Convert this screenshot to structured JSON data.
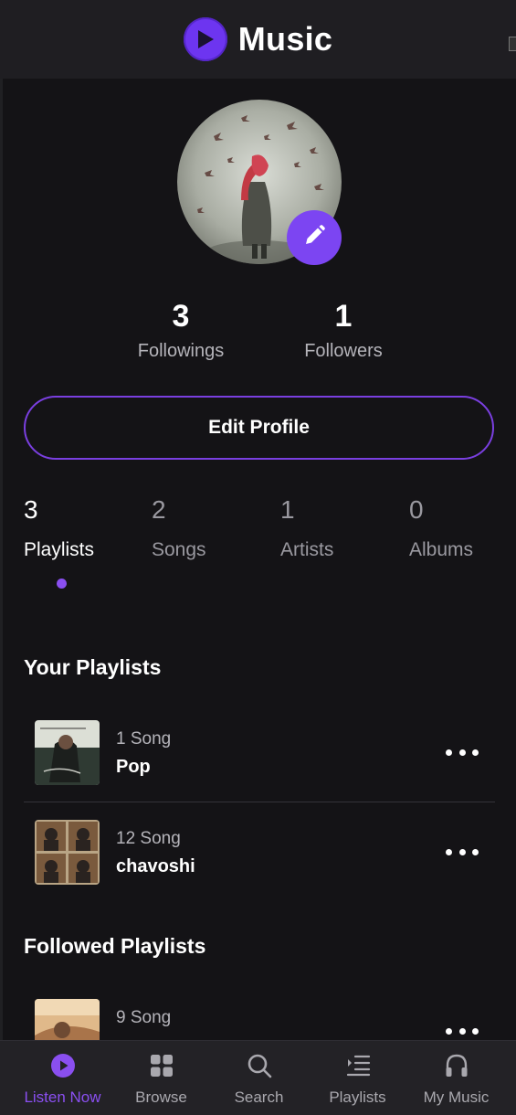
{
  "header": {
    "title": "Music",
    "logo_icon": "play-circle-icon"
  },
  "profile": {
    "avatar_icon": "profile-photo",
    "edit_icon": "pencil-icon",
    "followings": {
      "count": "3",
      "label": "Followings"
    },
    "followers": {
      "count": "1",
      "label": "Followers"
    },
    "edit_label": "Edit Profile"
  },
  "tabs": [
    {
      "count": "3",
      "label": "Playlists",
      "active": true
    },
    {
      "count": "2",
      "label": "Songs",
      "active": false
    },
    {
      "count": "1",
      "label": "Artists",
      "active": false
    },
    {
      "count": "0",
      "label": "Albums",
      "active": false
    }
  ],
  "your_playlists": {
    "title": "Your Playlists",
    "items": [
      {
        "count": "1 Song",
        "name": "Pop"
      },
      {
        "count": "12 Song",
        "name": "chavoshi"
      }
    ]
  },
  "followed_playlists": {
    "title": "Followed Playlists",
    "items": [
      {
        "count": "9 Song",
        "name": ""
      }
    ]
  },
  "bottom_nav": [
    {
      "label": "Listen Now",
      "icon": "play-circle-icon",
      "active": true
    },
    {
      "label": "Browse",
      "icon": "grid-icon",
      "active": false
    },
    {
      "label": "Search",
      "icon": "search-icon",
      "active": false
    },
    {
      "label": "Playlists",
      "icon": "playlist-icon",
      "active": false
    },
    {
      "label": "My Music",
      "icon": "headphones-icon",
      "active": false
    }
  ],
  "colors": {
    "accent": "#7c45f2",
    "background": "#141316",
    "bar": "#1f1e22"
  }
}
